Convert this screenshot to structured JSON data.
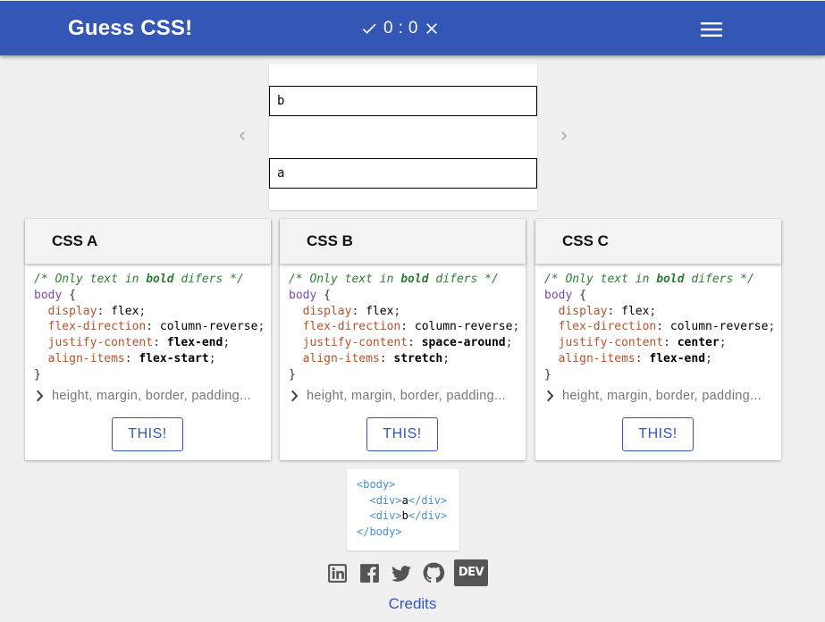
{
  "appbar": {
    "title": "Guess CSS!",
    "score_correct": "0",
    "score_separator": ":",
    "score_wrong": "0",
    "icons": [
      "check-icon",
      "close-icon",
      "menu-icon"
    ],
    "color": "#3457b5"
  },
  "preview": {
    "boxes": [
      "b",
      "a"
    ],
    "prev_icon": "chevron-left-icon",
    "next_icon": "chevron-right-icon"
  },
  "cards": [
    {
      "title": "CSS A",
      "comment_pre": "/* Only text in ",
      "comment_bold": "bold",
      "comment_post": " difers */",
      "selector": "body",
      "props": [
        {
          "name": "display",
          "value": "flex",
          "bold": false
        },
        {
          "name": "flex-direction",
          "value": "column-reverse",
          "bold": false
        },
        {
          "name": "justify-content",
          "value": "flex-end",
          "bold": true
        },
        {
          "name": "align-items",
          "value": "flex-start",
          "bold": true
        }
      ],
      "expander": "height, margin, border, padding...",
      "button": "THIS!"
    },
    {
      "title": "CSS B",
      "comment_pre": "/* Only text in ",
      "comment_bold": "bold",
      "comment_post": " difers */",
      "selector": "body",
      "props": [
        {
          "name": "display",
          "value": "flex",
          "bold": false
        },
        {
          "name": "flex-direction",
          "value": "column-reverse",
          "bold": false
        },
        {
          "name": "justify-content",
          "value": "space-around",
          "bold": true
        },
        {
          "name": "align-items",
          "value": "stretch",
          "bold": true
        }
      ],
      "expander": "height, margin, border, padding...",
      "button": "THIS!"
    },
    {
      "title": "CSS C",
      "comment_pre": "/* Only text in ",
      "comment_bold": "bold",
      "comment_post": " difers */",
      "selector": "body",
      "props": [
        {
          "name": "display",
          "value": "flex",
          "bold": false
        },
        {
          "name": "flex-direction",
          "value": "column-reverse",
          "bold": false
        },
        {
          "name": "justify-content",
          "value": "center",
          "bold": true
        },
        {
          "name": "align-items",
          "value": "flex-end",
          "bold": true
        }
      ],
      "expander": "height, margin, border, padding...",
      "button": "THIS!"
    }
  ],
  "html_snippet": {
    "body_open": "body",
    "div_tag": "div",
    "div1_text": "a",
    "div2_text": "b",
    "body_close": "body"
  },
  "social": {
    "icons": [
      "linkedin-icon",
      "facebook-icon",
      "twitter-icon",
      "github-icon",
      "dev-icon"
    ],
    "dev_label": "DEV"
  },
  "footer": {
    "credits": "Credits"
  }
}
